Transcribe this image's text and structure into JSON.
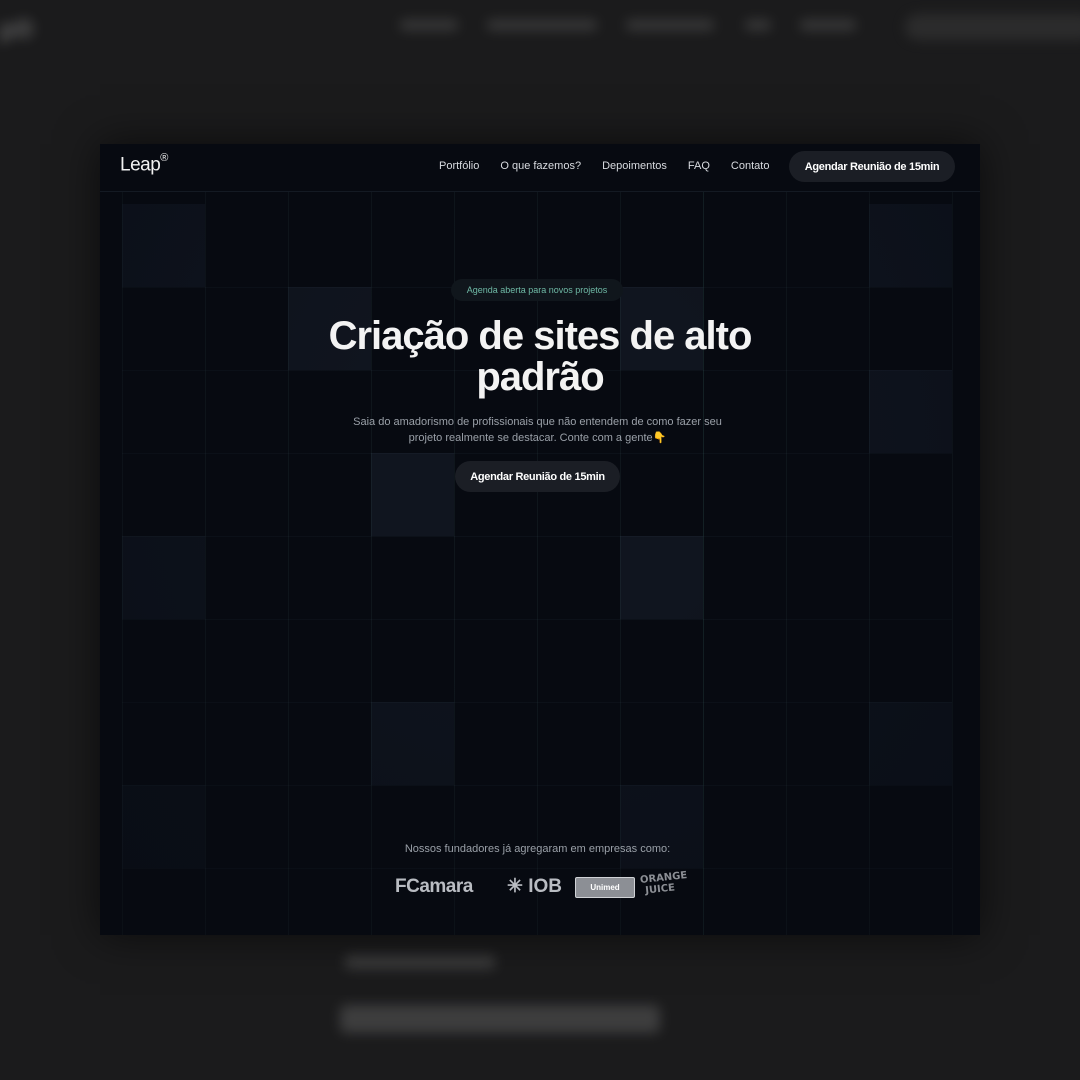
{
  "nav": {
    "logo": "Leap",
    "logo_mark": "®",
    "links": [
      "Portfólio",
      "O que fazemos?",
      "Depoimentos",
      "FAQ",
      "Contato"
    ],
    "cta": "Agendar Reunião de 15min"
  },
  "hero": {
    "badge": "Agenda aberta para novos projetos",
    "title": "Criação de sites de alto padrão",
    "subtitle": "Saia do amadorismo de profissionais que não entendem de como fazer seu projeto realmente se destacar. Conte com a gente👇",
    "cta": "Agendar Reunião de 15min"
  },
  "clients": {
    "label": "Nossos fundadores já agregaram em empresas como:",
    "logos": [
      "FCamara",
      "IOB",
      "Unimed",
      "ORANGE JUICE"
    ]
  },
  "colors": {
    "page_bg": "#1b1b1c",
    "frame_bg": "#070a11",
    "badge_text": "#6fb9a5",
    "button_bg": "#1b1e25"
  }
}
